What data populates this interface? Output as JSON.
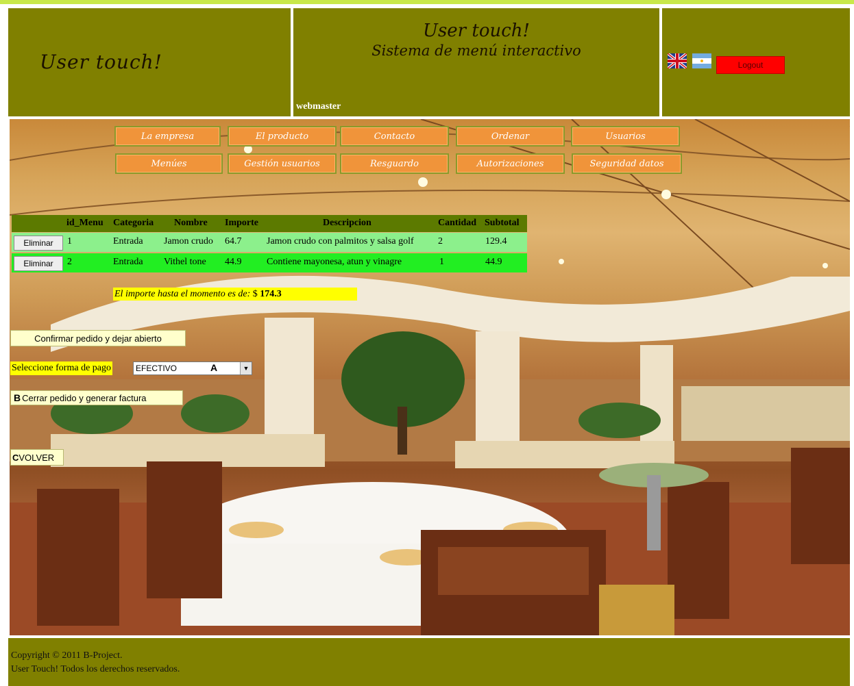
{
  "header": {
    "brand": "User touch!",
    "title": "User touch!",
    "subtitle": "Sistema de menú interactivo",
    "username": "webmaster",
    "logout_label": "Logout",
    "flags": [
      "uk-flag-icon",
      "argentina-flag-icon"
    ]
  },
  "nav": {
    "row1": [
      "La empresa",
      "El producto",
      "Contacto",
      "Ordenar",
      "Usuarios"
    ],
    "row2": [
      "Menúes",
      "Gestión usuarios",
      "Resguardo",
      "Autorizaciones",
      "Seguridad datos"
    ]
  },
  "order_table": {
    "columns": [
      "id_Menu",
      "Categoria",
      "Nombre",
      "Importe",
      "Descripcion",
      "Cantidad",
      "Subtotal"
    ],
    "rows": [
      {
        "action": "Eliminar",
        "id_menu": "1",
        "categoria": "Entrada",
        "nombre": "Jamon crudo",
        "importe": "64.7",
        "descripcion": "Jamon crudo con palmitos y salsa golf",
        "cantidad": "2",
        "subtotal": "129.4"
      },
      {
        "action": "Eliminar",
        "id_menu": "2",
        "categoria": "Entrada",
        "nombre": "Vithel tone",
        "importe": "44.9",
        "descripcion": "Contiene mayonesa, atun y vinagre",
        "cantidad": "1",
        "subtotal": "44.9"
      }
    ]
  },
  "total": {
    "label": "El importe hasta el momento es de:",
    "currency": "$",
    "amount": "174.3"
  },
  "actions": {
    "confirm_label": "Confirmar pedido y dejar abierto",
    "payment_label": "Seleccione forma de pago",
    "payment_value": "EFECTIVO",
    "close_label": "Cerrar pedido y generar factura",
    "back_label": "VOLVER",
    "marker_a": "A",
    "marker_b": "B",
    "marker_c": "C"
  },
  "footer": {
    "line1": "Copyright © 2011 B-Project.",
    "line2": "User Touch! Todos los derechos reservados."
  },
  "colors": {
    "header_bg": "#808000",
    "nav_button": "#f0943a",
    "logout": "#ff0000",
    "row1": "#8cf08c",
    "row2": "#22ee22",
    "highlight": "#ffff00"
  }
}
